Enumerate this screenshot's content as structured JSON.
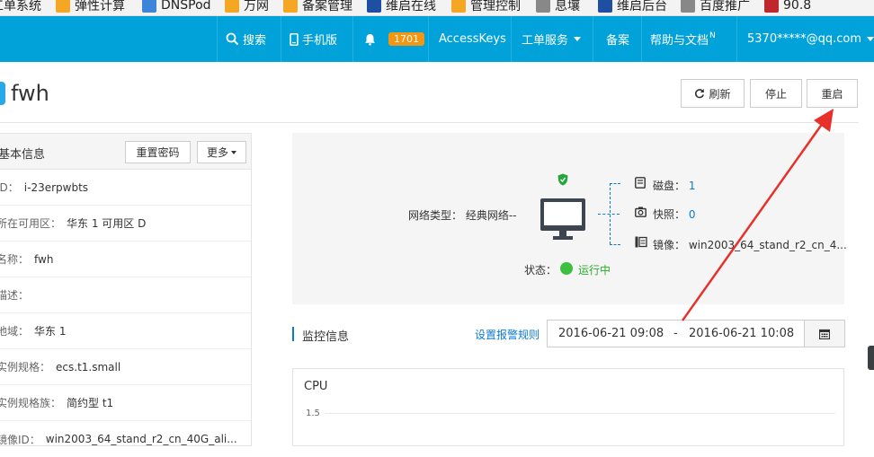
{
  "bookmarks": [
    {
      "label": "工单系统",
      "icon": "orange-icon"
    },
    {
      "label": "弹性计算",
      "icon": "orange-icon"
    },
    {
      "label": "DNSPod",
      "icon": "dnspod-icon"
    },
    {
      "label": "万网",
      "icon": "orange-icon"
    },
    {
      "label": "备案管理",
      "icon": "orange-icon"
    },
    {
      "label": "维启在线",
      "icon": "blue-icon"
    },
    {
      "label": "管理控制",
      "icon": "orange-icon"
    },
    {
      "label": "息壤",
      "icon": "globe-icon"
    },
    {
      "label": "维启后台",
      "icon": "blue-icon"
    },
    {
      "label": "百度推广",
      "icon": "globe-icon"
    },
    {
      "label": "90.8",
      "icon": "red-icon"
    }
  ],
  "topnav": {
    "search": "搜索",
    "mobile": "手机版",
    "notify_count": "1701",
    "accesskeys": "AccessKeys",
    "tickets": "工单服务",
    "beian": "备案",
    "help": "帮助与文档",
    "help_badge": "N",
    "account": "5370*****@qq.com"
  },
  "instance": {
    "name": "fwh",
    "actions": {
      "refresh": "刷新",
      "stop": "停止",
      "restart": "重启"
    }
  },
  "basic_info": {
    "title": "基本信息",
    "reset_password": "重置密码",
    "more": "更多",
    "rows": [
      {
        "key": "ID：",
        "value": "i-23erpwbts"
      },
      {
        "key": "所在可用区：",
        "value": "华东 1 可用区 D"
      },
      {
        "key": "名称：",
        "value": "fwh"
      },
      {
        "key": "描述：",
        "value": ""
      },
      {
        "key": "地域：",
        "value": "华东 1"
      },
      {
        "key": "实例规格：",
        "value": "ecs.t1.small"
      },
      {
        "key": "实例规格族：",
        "value": "简约型 t1"
      },
      {
        "key": "镜像ID：",
        "value": "win2003_64_stand_r2_cn_40G_ali..."
      }
    ]
  },
  "overview": {
    "network_label": "网络类型：",
    "network_value": "经典网络--",
    "disk_label": "磁盘：",
    "disk_value": "1",
    "snapshot_label": "快照：",
    "snapshot_value": "0",
    "image_label": "镜像：",
    "image_value": "win2003_64_stand_r2_cn_4...",
    "status_label": "状态：",
    "status_value": "运行中"
  },
  "monitor": {
    "title": "监控信息",
    "alarm_link": "设置报警规则",
    "start": "2016-06-21 09:08",
    "sep": "-",
    "end": "2016-06-21 10:08"
  },
  "cpu_chart": {
    "title": "CPU",
    "tick": "1.5"
  }
}
